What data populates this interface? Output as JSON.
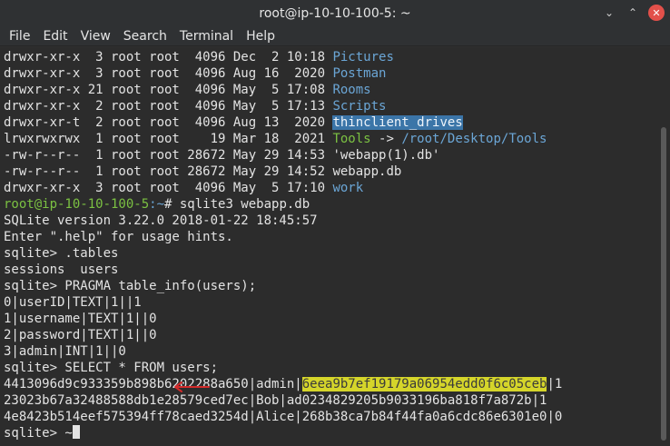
{
  "window": {
    "title": "root@ip-10-10-100-5: ~"
  },
  "menu": [
    "File",
    "Edit",
    "View",
    "Search",
    "Terminal",
    "Help"
  ],
  "terminal": {
    "listing": [
      {
        "meta": "drwxr-xr-x  3 root root  4096 Dec  2 10:18 ",
        "name": "Pictures"
      },
      {
        "meta": "drwxr-xr-x  3 root root  4096 Aug 16  2020 ",
        "name": "Postman"
      },
      {
        "meta": "drwxr-xr-x 21 root root  4096 May  5 17:08 ",
        "name": "Rooms"
      },
      {
        "meta": "drwxr-xr-x  2 root root  4096 May  5 17:13 ",
        "name": "Scripts"
      },
      {
        "meta": "drwxr-xr-t  2 root root  4096 Aug 13  2020 ",
        "name": "thinclient_drives"
      },
      {
        "meta": "lrwxrwxrwx  1 root root    19 Mar 18  2021 ",
        "name": "Tools",
        "arrow": " -> ",
        "target": "/root/Desktop/Tools"
      },
      {
        "meta": "-rw-r--r--  1 root root 28672 May 29 14:53 ",
        "name": "'webapp(1).db'"
      },
      {
        "meta": "-rw-r--r--  1 root root 28672 May 29 14:52 ",
        "name": "webapp.db"
      },
      {
        "meta": "drwxr-xr-x  3 root root  4096 May  5 17:10 ",
        "name": "work"
      }
    ],
    "prompt": {
      "user_host": "root@ip-10-10-100-5",
      "path": ":~",
      "symbol": "# ",
      "command": "sqlite3 webapp.db"
    },
    "output": [
      "SQLite version 3.22.0 2018-01-22 18:45:57",
      "Enter \".help\" for usage hints.",
      "sqlite> .tables",
      "sessions  users",
      "sqlite> PRAGMA table_info(users);",
      "0|userID|TEXT|1||1",
      "1|username|TEXT|1||0",
      "2|password|TEXT|1||0",
      "3|admin|INT|1||0",
      "sqlite> SELECT * FROM users;"
    ],
    "row1": {
      "prefix": "4413096d9c933359b898b6202288a650|admin|",
      "hash": "6eea9b7ef19179a06954edd0f6c05ceb",
      "suffix": "|1"
    },
    "rows": [
      "23023b67a32488588db1e28579ced7ec|Bob|ad0234829205b9033196ba818f7a872b|1",
      "4e8423b514eef575394ff78caed3254d|Alice|268b38ca7b84f44fa0a6cdc86e6301e0|0"
    ],
    "final_prompt": "sqlite> ~",
    "annotation_color": "#d32a2a",
    "colors": {
      "dir": "#6ba6d6",
      "link": "#7bc142",
      "highlight": "#d5d52a"
    }
  }
}
